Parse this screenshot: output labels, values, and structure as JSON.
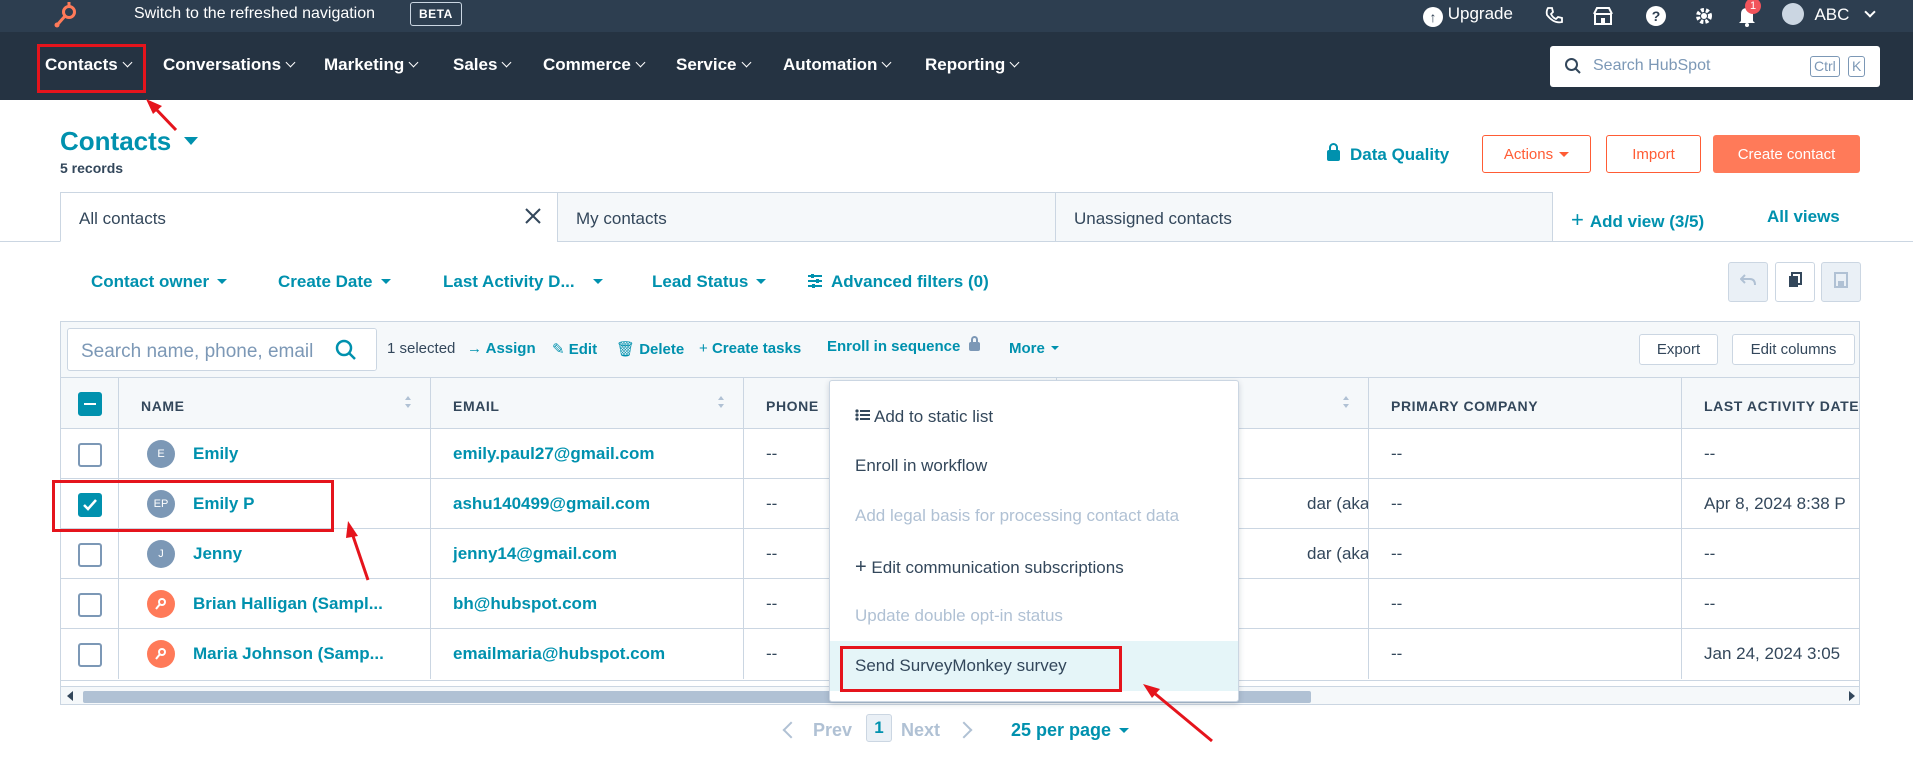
{
  "topbar": {
    "switch_text": "Switch to the refreshed navigation",
    "beta_label": "BETA",
    "upgrade_label": "Upgrade",
    "account_label": "ABC",
    "notification_count": "1"
  },
  "nav": {
    "items": [
      {
        "label": "Contacts"
      },
      {
        "label": "Conversations"
      },
      {
        "label": "Marketing"
      },
      {
        "label": "Sales"
      },
      {
        "label": "Commerce"
      },
      {
        "label": "Service"
      },
      {
        "label": "Automation"
      },
      {
        "label": "Reporting"
      }
    ],
    "search_placeholder": "Search HubSpot",
    "shortcut_ctrl": "Ctrl",
    "shortcut_k": "K"
  },
  "header": {
    "title": "Contacts",
    "records": "5 records",
    "data_quality": "Data Quality",
    "actions_label": "Actions",
    "import_label": "Import",
    "create_label": "Create contact"
  },
  "views": {
    "tabs": [
      {
        "label": "All contacts"
      },
      {
        "label": "My contacts"
      },
      {
        "label": "Unassigned contacts"
      }
    ],
    "add_view": "Add view (3/5)",
    "all_views": "All views"
  },
  "filters": {
    "items": [
      {
        "label": "Contact owner"
      },
      {
        "label": "Create Date"
      },
      {
        "label": "Last Activity D..."
      },
      {
        "label": "Lead Status"
      }
    ],
    "advanced": "Advanced filters (0)"
  },
  "toolbar": {
    "search_placeholder": "Search name, phone, email",
    "selected": "1 selected",
    "assign": "Assign",
    "edit": "Edit",
    "delete": "Delete",
    "create_tasks": "Create tasks",
    "enroll": "Enroll in sequence",
    "more": "More",
    "export": "Export",
    "edit_columns": "Edit columns"
  },
  "table": {
    "headers": {
      "name": "NAME",
      "email": "EMAIL",
      "phone": "PHONE",
      "primary_company": "PRIMARY COMPANY",
      "last_activity": "LAST ACTIVITY DATE"
    },
    "rows": [
      {
        "initials": "E",
        "name": "Emily",
        "email": "emily.paul27@gmail.com",
        "phone": "--",
        "owner": "",
        "company": "--",
        "last_activity": "--",
        "checked": false
      },
      {
        "initials": "EP",
        "name": "Emily P",
        "email": "ashu140499@gmail.com",
        "phone": "--",
        "owner": "dar (akan...",
        "company": "--",
        "last_activity": "Apr 8, 2024 8:38 P",
        "checked": true
      },
      {
        "initials": "J",
        "name": "Jenny",
        "email": "jenny14@gmail.com",
        "phone": "--",
        "owner": "dar (akan...",
        "company": "--",
        "last_activity": "--",
        "checked": false
      },
      {
        "initials": "",
        "name": "Brian Halligan (Sampl...",
        "email": "bh@hubspot.com",
        "phone": "--",
        "owner": "",
        "company": "--",
        "last_activity": "--",
        "checked": false
      },
      {
        "initials": "",
        "name": "Maria Johnson (Samp...",
        "email": "emailmaria@hubspot.com",
        "phone": "--",
        "owner": "",
        "company": "--",
        "last_activity": "Jan 24, 2024 3:05",
        "checked": false
      }
    ]
  },
  "more_menu": {
    "items": [
      {
        "label": "Add to static list",
        "disabled": false
      },
      {
        "label": "Enroll in workflow",
        "disabled": false
      },
      {
        "label": "Add legal basis for processing contact data",
        "disabled": true
      },
      {
        "label": "Edit communication subscriptions",
        "disabled": false
      },
      {
        "label": "Update double opt-in status",
        "disabled": true
      },
      {
        "label": "Send SurveyMonkey survey",
        "disabled": false
      }
    ]
  },
  "pagination": {
    "prev": "Prev",
    "page": "1",
    "next": "Next",
    "per_page": "25 per page"
  },
  "colors": {
    "nav_bg": "#253342",
    "topbar_bg": "#2d3e50",
    "accent": "#0091ae",
    "orange": "#ff7a59",
    "annotation": "#e5141c"
  }
}
